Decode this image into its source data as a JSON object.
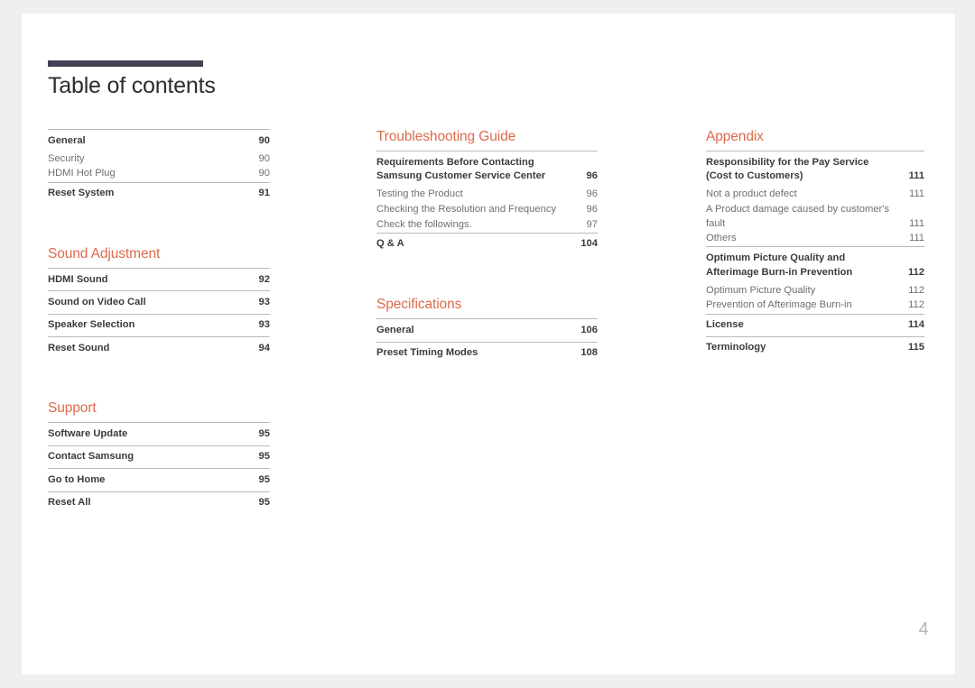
{
  "document": {
    "title": "Table of contents",
    "folio": "4",
    "accent_color": "#dd6a4c",
    "rule_color": "#464155",
    "page_background": "#ffffff",
    "canvas_background": "#efefef"
  },
  "columns": [
    {
      "name": "column-left",
      "sections": [
        {
          "heading": null,
          "groups": [
            {
              "entries": [
                {
                  "label": "General",
                  "page": "90",
                  "level": "main"
                },
                {
                  "label": "Security",
                  "page": "90",
                  "level": "sub"
                },
                {
                  "label": "HDMI Hot Plug",
                  "page": "90",
                  "level": "sub"
                }
              ]
            },
            {
              "entries": [
                {
                  "label": "Reset System",
                  "page": "91",
                  "level": "main"
                }
              ]
            }
          ]
        },
        {
          "heading": "Sound Adjustment",
          "groups": [
            {
              "entries": [
                {
                  "label": "HDMI Sound",
                  "page": "92",
                  "level": "main"
                }
              ]
            },
            {
              "entries": [
                {
                  "label": "Sound on Video Call",
                  "page": "93",
                  "level": "main"
                }
              ]
            },
            {
              "entries": [
                {
                  "label": "Speaker Selection",
                  "page": "93",
                  "level": "main"
                }
              ]
            },
            {
              "entries": [
                {
                  "label": "Reset Sound",
                  "page": "94",
                  "level": "main"
                }
              ]
            }
          ]
        },
        {
          "heading": "Support",
          "groups": [
            {
              "entries": [
                {
                  "label": "Software Update",
                  "page": "95",
                  "level": "main"
                }
              ]
            },
            {
              "entries": [
                {
                  "label": "Contact Samsung",
                  "page": "95",
                  "level": "main"
                }
              ]
            },
            {
              "entries": [
                {
                  "label": "Go to Home",
                  "page": "95",
                  "level": "main"
                }
              ]
            },
            {
              "entries": [
                {
                  "label": "Reset All",
                  "page": "95",
                  "level": "main"
                }
              ]
            }
          ]
        }
      ]
    },
    {
      "name": "column-middle",
      "sections": [
        {
          "heading": "Troubleshooting Guide",
          "groups": [
            {
              "entries": [
                {
                  "label": "Requirements Before Contacting Samsung Customer Service Center",
                  "page": "96",
                  "level": "main"
                },
                {
                  "label": "Testing the Product",
                  "page": "96",
                  "level": "sub"
                },
                {
                  "label": "Checking the Resolution and Frequency",
                  "page": "96",
                  "level": "sub"
                },
                {
                  "label": "Check the followings.",
                  "page": "97",
                  "level": "sub"
                }
              ]
            },
            {
              "entries": [
                {
                  "label": "Q & A",
                  "page": "104",
                  "level": "main"
                }
              ]
            }
          ]
        },
        {
          "heading": "Specifications",
          "groups": [
            {
              "entries": [
                {
                  "label": "General",
                  "page": "106",
                  "level": "main"
                }
              ]
            },
            {
              "entries": [
                {
                  "label": "Preset Timing Modes",
                  "page": "108",
                  "level": "main"
                }
              ]
            }
          ]
        }
      ]
    },
    {
      "name": "column-right",
      "sections": [
        {
          "heading": "Appendix",
          "groups": [
            {
              "entries": [
                {
                  "label": "Responsibility for the Pay Service (Cost to Customers)",
                  "page": "111",
                  "level": "main"
                },
                {
                  "label": "Not a product defect",
                  "page": "111",
                  "level": "sub"
                },
                {
                  "label": "A Product damage caused by customer's fault",
                  "page": "111",
                  "level": "sub"
                },
                {
                  "label": "Others",
                  "page": "111",
                  "level": "sub"
                }
              ]
            },
            {
              "entries": [
                {
                  "label": "Optimum Picture Quality and Afterimage Burn-in Prevention",
                  "page": "112",
                  "level": "main"
                },
                {
                  "label": "Optimum Picture Quality",
                  "page": "112",
                  "level": "sub"
                },
                {
                  "label": "Prevention of Afterimage Burn-in",
                  "page": "112",
                  "level": "sub"
                }
              ]
            },
            {
              "entries": [
                {
                  "label": "License",
                  "page": "114",
                  "level": "main"
                }
              ]
            },
            {
              "entries": [
                {
                  "label": "Terminology",
                  "page": "115",
                  "level": "main"
                }
              ]
            }
          ]
        }
      ]
    }
  ]
}
